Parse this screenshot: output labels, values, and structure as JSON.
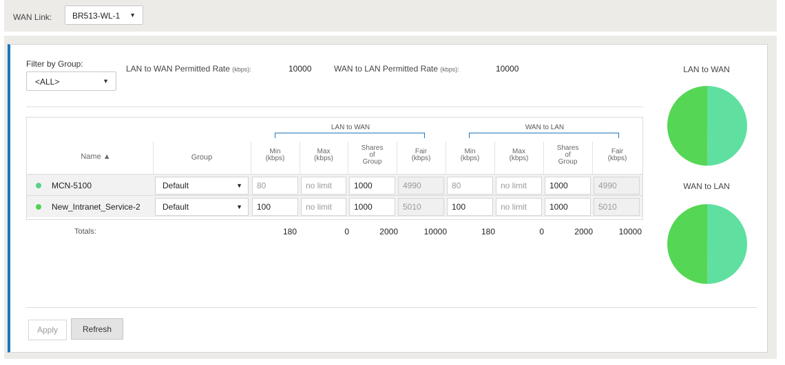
{
  "wan_link": {
    "label": "WAN Link:",
    "value": "BR513-WL-1"
  },
  "filter": {
    "label": "Filter by Group:",
    "value": "<ALL>"
  },
  "rates": {
    "lan_to_wan_label": "LAN to WAN Permitted Rate",
    "lan_to_wan_unit": "(kbps):",
    "lan_to_wan_value": "10000",
    "wan_to_lan_label": "WAN to LAN Permitted Rate",
    "wan_to_lan_unit": "(kbps):",
    "wan_to_lan_value": "10000"
  },
  "table": {
    "group_titles": [
      "LAN to WAN",
      "WAN to LAN"
    ],
    "headers": {
      "name": "Name",
      "group": "Group",
      "min": [
        "Min",
        "(kbps)"
      ],
      "max": [
        "Max",
        "(kbps)"
      ],
      "shares": [
        "Shares",
        "of",
        "Group"
      ],
      "fair": [
        "Fair",
        "(kbps)"
      ]
    },
    "rows": [
      {
        "name": "MCN-5100",
        "group": "Default",
        "dot_color": "#5ad28a",
        "l2w": {
          "min": "80",
          "max": "no limit",
          "shares": "1000",
          "fair": "4990"
        },
        "w2l": {
          "min": "80",
          "max": "no limit",
          "shares": "1000",
          "fair": "4990"
        }
      },
      {
        "name": "New_Intranet_Service-2",
        "group": "Default",
        "dot_color": "#52d152",
        "l2w": {
          "min": "100",
          "max": "no limit",
          "shares": "1000",
          "fair": "5010"
        },
        "w2l": {
          "min": "100",
          "max": "no limit",
          "shares": "1000",
          "fair": "5010"
        }
      }
    ],
    "totals": {
      "label": "Totals:",
      "l2w": {
        "min": "180",
        "max": "0",
        "shares": "2000",
        "fair": "10000"
      },
      "w2l": {
        "min": "180",
        "max": "0",
        "shares": "2000",
        "fair": "10000"
      }
    }
  },
  "charts": {
    "lan_to_wan_title": "LAN to WAN",
    "wan_to_lan_title": "WAN to LAN",
    "colors": [
      "#5ad28a",
      "#52d152"
    ],
    "lan_to_wan_shares": [
      4990,
      5010
    ],
    "wan_to_lan_shares": [
      4990,
      5010
    ]
  },
  "buttons": {
    "apply": "Apply",
    "refresh": "Refresh"
  }
}
